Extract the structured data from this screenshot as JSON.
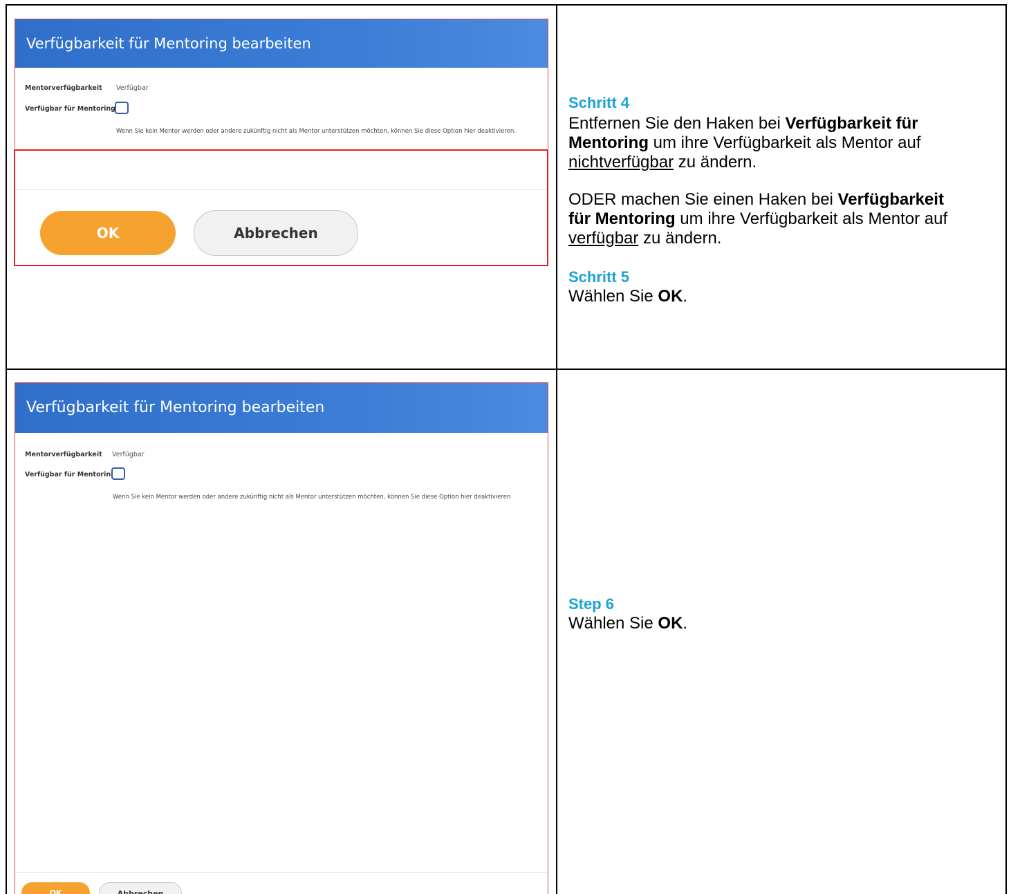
{
  "row1": {
    "screenshot": {
      "title": "Verfügbarkeit für Mentoring bearbeiten",
      "field1_label": "Mentorverfügbarkeit",
      "field1_value": "Verfügbar",
      "field2_label": "Verfügbar für Mentoring",
      "field2_checked": false,
      "description": "Wenn Sie kein Mentor werden oder andere zukünftig nicht als Mentor unterstützen möchten, können Sie diese Option hier deaktivieren.",
      "ok_label": "OK",
      "cancel_label": "Abbrechen"
    },
    "instructions": {
      "step4_heading": "Schritt 4",
      "step4_p1_a": "Entfernen Sie den Haken bei ",
      "step4_p1_b": "Verfügbarkeit für Mentoring",
      "step4_p1_c": " um ihre Verfügbarkeit als Mentor auf ",
      "step4_p1_d": "nichtverfügbar",
      "step4_p1_e": " zu ändern.",
      "step4_p2_a": "ODER machen Sie einen Haken bei ",
      "step4_p2_b": "Verfügbarkeit für Mentoring",
      "step4_p2_c": " um ihre Verfügbarkeit als Mentor auf ",
      "step4_p2_d": "verfügbar",
      "step4_p2_e": " zu ändern.",
      "step5_heading": "Schritt 5",
      "step5_a": "Wählen Sie ",
      "step5_b": "OK",
      "step5_c": "."
    }
  },
  "row2": {
    "screenshot": {
      "title": "Verfügbarkeit für Mentoring bearbeiten",
      "field1_label": "Mentorverfügbarkeit",
      "field1_value": "Verfügbar",
      "field2_label": "Verfügbar für Mentoring",
      "field2_checked": false,
      "description": "Wenn Sie kein Mentor werden oder andere zukünftig nicht als Mentor unterstützen möchten, können Sie diese Option hier deaktivieren",
      "ok_label": "OK",
      "cancel_label": "Abbrechen"
    },
    "instructions": {
      "step6_heading": "Step 6",
      "step6_a": "Wählen Sie ",
      "step6_b": "OK",
      "step6_c": "."
    }
  }
}
